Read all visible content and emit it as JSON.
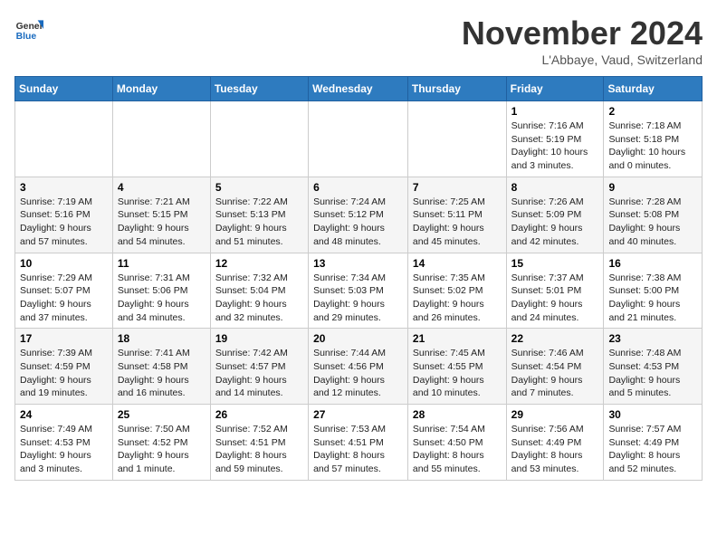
{
  "header": {
    "logo_general": "General",
    "logo_blue": "Blue",
    "month_title": "November 2024",
    "location": "L'Abbaye, Vaud, Switzerland"
  },
  "calendar": {
    "days_of_week": [
      "Sunday",
      "Monday",
      "Tuesday",
      "Wednesday",
      "Thursday",
      "Friday",
      "Saturday"
    ],
    "weeks": [
      [
        {
          "day": "",
          "info": ""
        },
        {
          "day": "",
          "info": ""
        },
        {
          "day": "",
          "info": ""
        },
        {
          "day": "",
          "info": ""
        },
        {
          "day": "",
          "info": ""
        },
        {
          "day": "1",
          "info": "Sunrise: 7:16 AM\nSunset: 5:19 PM\nDaylight: 10 hours\nand 3 minutes."
        },
        {
          "day": "2",
          "info": "Sunrise: 7:18 AM\nSunset: 5:18 PM\nDaylight: 10 hours\nand 0 minutes."
        }
      ],
      [
        {
          "day": "3",
          "info": "Sunrise: 7:19 AM\nSunset: 5:16 PM\nDaylight: 9 hours\nand 57 minutes."
        },
        {
          "day": "4",
          "info": "Sunrise: 7:21 AM\nSunset: 5:15 PM\nDaylight: 9 hours\nand 54 minutes."
        },
        {
          "day": "5",
          "info": "Sunrise: 7:22 AM\nSunset: 5:13 PM\nDaylight: 9 hours\nand 51 minutes."
        },
        {
          "day": "6",
          "info": "Sunrise: 7:24 AM\nSunset: 5:12 PM\nDaylight: 9 hours\nand 48 minutes."
        },
        {
          "day": "7",
          "info": "Sunrise: 7:25 AM\nSunset: 5:11 PM\nDaylight: 9 hours\nand 45 minutes."
        },
        {
          "day": "8",
          "info": "Sunrise: 7:26 AM\nSunset: 5:09 PM\nDaylight: 9 hours\nand 42 minutes."
        },
        {
          "day": "9",
          "info": "Sunrise: 7:28 AM\nSunset: 5:08 PM\nDaylight: 9 hours\nand 40 minutes."
        }
      ],
      [
        {
          "day": "10",
          "info": "Sunrise: 7:29 AM\nSunset: 5:07 PM\nDaylight: 9 hours\nand 37 minutes."
        },
        {
          "day": "11",
          "info": "Sunrise: 7:31 AM\nSunset: 5:06 PM\nDaylight: 9 hours\nand 34 minutes."
        },
        {
          "day": "12",
          "info": "Sunrise: 7:32 AM\nSunset: 5:04 PM\nDaylight: 9 hours\nand 32 minutes."
        },
        {
          "day": "13",
          "info": "Sunrise: 7:34 AM\nSunset: 5:03 PM\nDaylight: 9 hours\nand 29 minutes."
        },
        {
          "day": "14",
          "info": "Sunrise: 7:35 AM\nSunset: 5:02 PM\nDaylight: 9 hours\nand 26 minutes."
        },
        {
          "day": "15",
          "info": "Sunrise: 7:37 AM\nSunset: 5:01 PM\nDaylight: 9 hours\nand 24 minutes."
        },
        {
          "day": "16",
          "info": "Sunrise: 7:38 AM\nSunset: 5:00 PM\nDaylight: 9 hours\nand 21 minutes."
        }
      ],
      [
        {
          "day": "17",
          "info": "Sunrise: 7:39 AM\nSunset: 4:59 PM\nDaylight: 9 hours\nand 19 minutes."
        },
        {
          "day": "18",
          "info": "Sunrise: 7:41 AM\nSunset: 4:58 PM\nDaylight: 9 hours\nand 16 minutes."
        },
        {
          "day": "19",
          "info": "Sunrise: 7:42 AM\nSunset: 4:57 PM\nDaylight: 9 hours\nand 14 minutes."
        },
        {
          "day": "20",
          "info": "Sunrise: 7:44 AM\nSunset: 4:56 PM\nDaylight: 9 hours\nand 12 minutes."
        },
        {
          "day": "21",
          "info": "Sunrise: 7:45 AM\nSunset: 4:55 PM\nDaylight: 9 hours\nand 10 minutes."
        },
        {
          "day": "22",
          "info": "Sunrise: 7:46 AM\nSunset: 4:54 PM\nDaylight: 9 hours\nand 7 minutes."
        },
        {
          "day": "23",
          "info": "Sunrise: 7:48 AM\nSunset: 4:53 PM\nDaylight: 9 hours\nand 5 minutes."
        }
      ],
      [
        {
          "day": "24",
          "info": "Sunrise: 7:49 AM\nSunset: 4:53 PM\nDaylight: 9 hours\nand 3 minutes."
        },
        {
          "day": "25",
          "info": "Sunrise: 7:50 AM\nSunset: 4:52 PM\nDaylight: 9 hours\nand 1 minute."
        },
        {
          "day": "26",
          "info": "Sunrise: 7:52 AM\nSunset: 4:51 PM\nDaylight: 8 hours\nand 59 minutes."
        },
        {
          "day": "27",
          "info": "Sunrise: 7:53 AM\nSunset: 4:51 PM\nDaylight: 8 hours\nand 57 minutes."
        },
        {
          "day": "28",
          "info": "Sunrise: 7:54 AM\nSunset: 4:50 PM\nDaylight: 8 hours\nand 55 minutes."
        },
        {
          "day": "29",
          "info": "Sunrise: 7:56 AM\nSunset: 4:49 PM\nDaylight: 8 hours\nand 53 minutes."
        },
        {
          "day": "30",
          "info": "Sunrise: 7:57 AM\nSunset: 4:49 PM\nDaylight: 8 hours\nand 52 minutes."
        }
      ]
    ]
  }
}
